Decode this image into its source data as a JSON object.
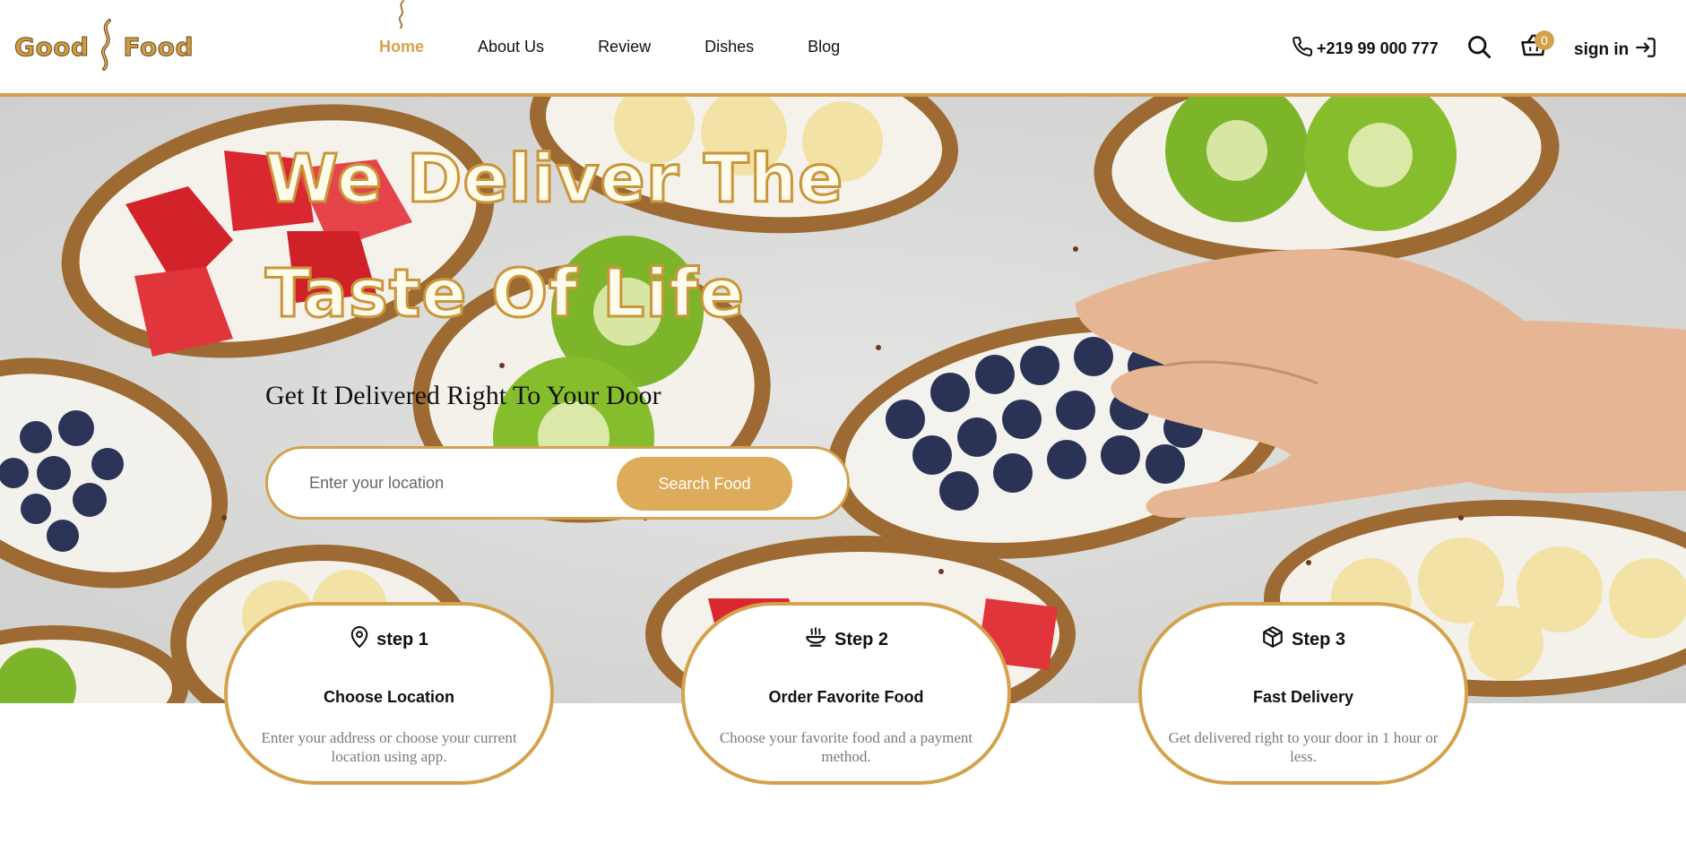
{
  "brand": {
    "left": "Good",
    "right": "Food"
  },
  "nav": {
    "items": [
      {
        "label": "Home"
      },
      {
        "label": "About Us"
      },
      {
        "label": "Review"
      },
      {
        "label": "Dishes"
      },
      {
        "label": "Blog"
      }
    ],
    "active": "Home"
  },
  "header": {
    "phone": "+219 99 000 777",
    "cart_count": "0",
    "signin_label": "sign in"
  },
  "hero": {
    "title_line1": "We Deliver The",
    "title_line2": "Taste Of Life",
    "subtitle": "Get It Delivered Right To Your Door",
    "search_placeholder": "Enter your location",
    "search_button": "Search Food"
  },
  "steps": [
    {
      "label": "step 1",
      "icon": "map-pin-icon",
      "title": "Choose Location",
      "description": "Enter your address or choose your current location using app."
    },
    {
      "label": "Step 2",
      "icon": "food-bowl-icon",
      "title": "Order Favorite Food",
      "description": "Choose your favorite food and a payment method."
    },
    {
      "label": "Step 3",
      "icon": "package-icon",
      "title": "Fast Delivery",
      "description": "Get delivered right to your door in 1 hour or less."
    }
  ],
  "colors": {
    "accent": "#d4a24c",
    "button": "#ddac5a",
    "text": "#111111",
    "muted": "#7a7a7a"
  }
}
